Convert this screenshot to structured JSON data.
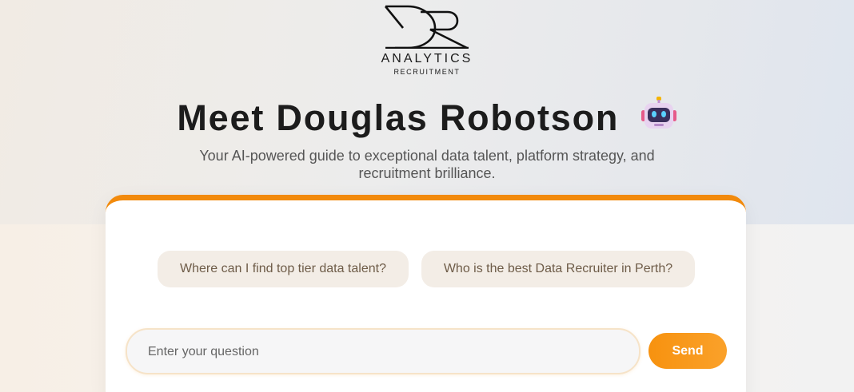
{
  "logo": {
    "mark": "DR",
    "wordmark": "ANALYTICS",
    "sub": "RECRUITMENT"
  },
  "hero": {
    "title": "Meet Douglas Robotson",
    "title_icon": "robot-icon",
    "subtitle": "Your AI-powered guide to exceptional data talent, platform strategy, and recruitment brilliance."
  },
  "chat": {
    "suggestions": [
      "Where can I find top tier data talent?",
      "Who is the best Data Recruiter in Perth?"
    ],
    "input": {
      "placeholder": "Enter your question",
      "value": ""
    },
    "send_label": "Send"
  },
  "colors": {
    "accent": "#f28a0c",
    "chip_bg": "#f3ede6",
    "chip_text": "#6e5c48",
    "title": "#1c1c1c"
  }
}
